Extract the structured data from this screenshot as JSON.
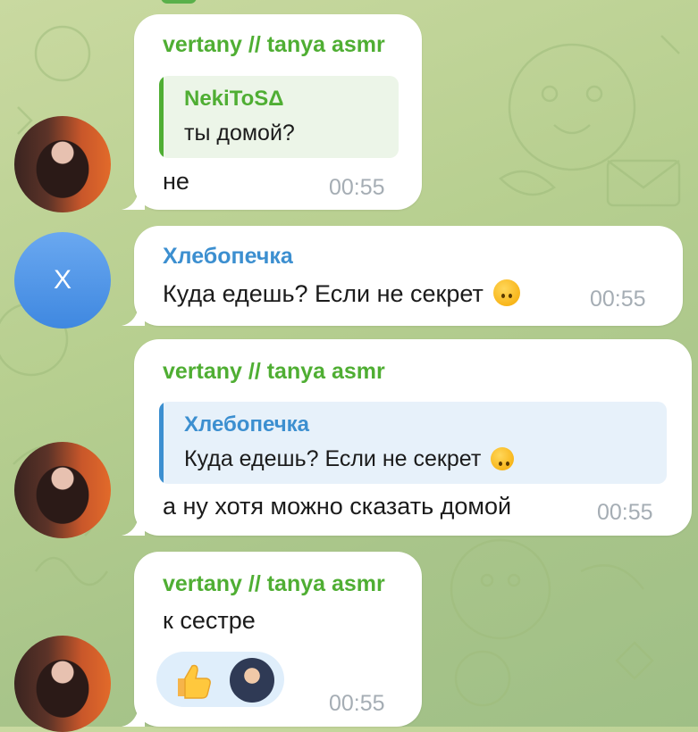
{
  "colors": {
    "sender_green": "#4fae33",
    "sender_blue": "#3c8fd0",
    "time_gray": "#a5adb4",
    "background": "#b7cf90"
  },
  "messages": [
    {
      "sender": "vertany // tanya asmr",
      "reply": {
        "name": "NekiToSΔ",
        "text": "ты домой?"
      },
      "text": "не",
      "time": "00:55",
      "avatar": "photo"
    },
    {
      "sender": "Хлебопечка",
      "text": "Куда едешь? Если не секрет",
      "emoji": "upside-down-face",
      "time": "00:55",
      "avatar": "Х"
    },
    {
      "sender": "vertany // tanya asmr",
      "reply": {
        "name": "Хлебопечка",
        "text": "Куда едешь? Если не секрет",
        "emoji": "upside-down-face"
      },
      "text": "а ну хотя можно сказать домой",
      "time": "00:55",
      "avatar": "photo"
    },
    {
      "sender": "vertany // tanya asmr",
      "text": "к сестре",
      "time": "00:55",
      "reaction": {
        "emoji": "thumbs-up",
        "by": "avatar"
      },
      "avatar": "photo"
    }
  ]
}
